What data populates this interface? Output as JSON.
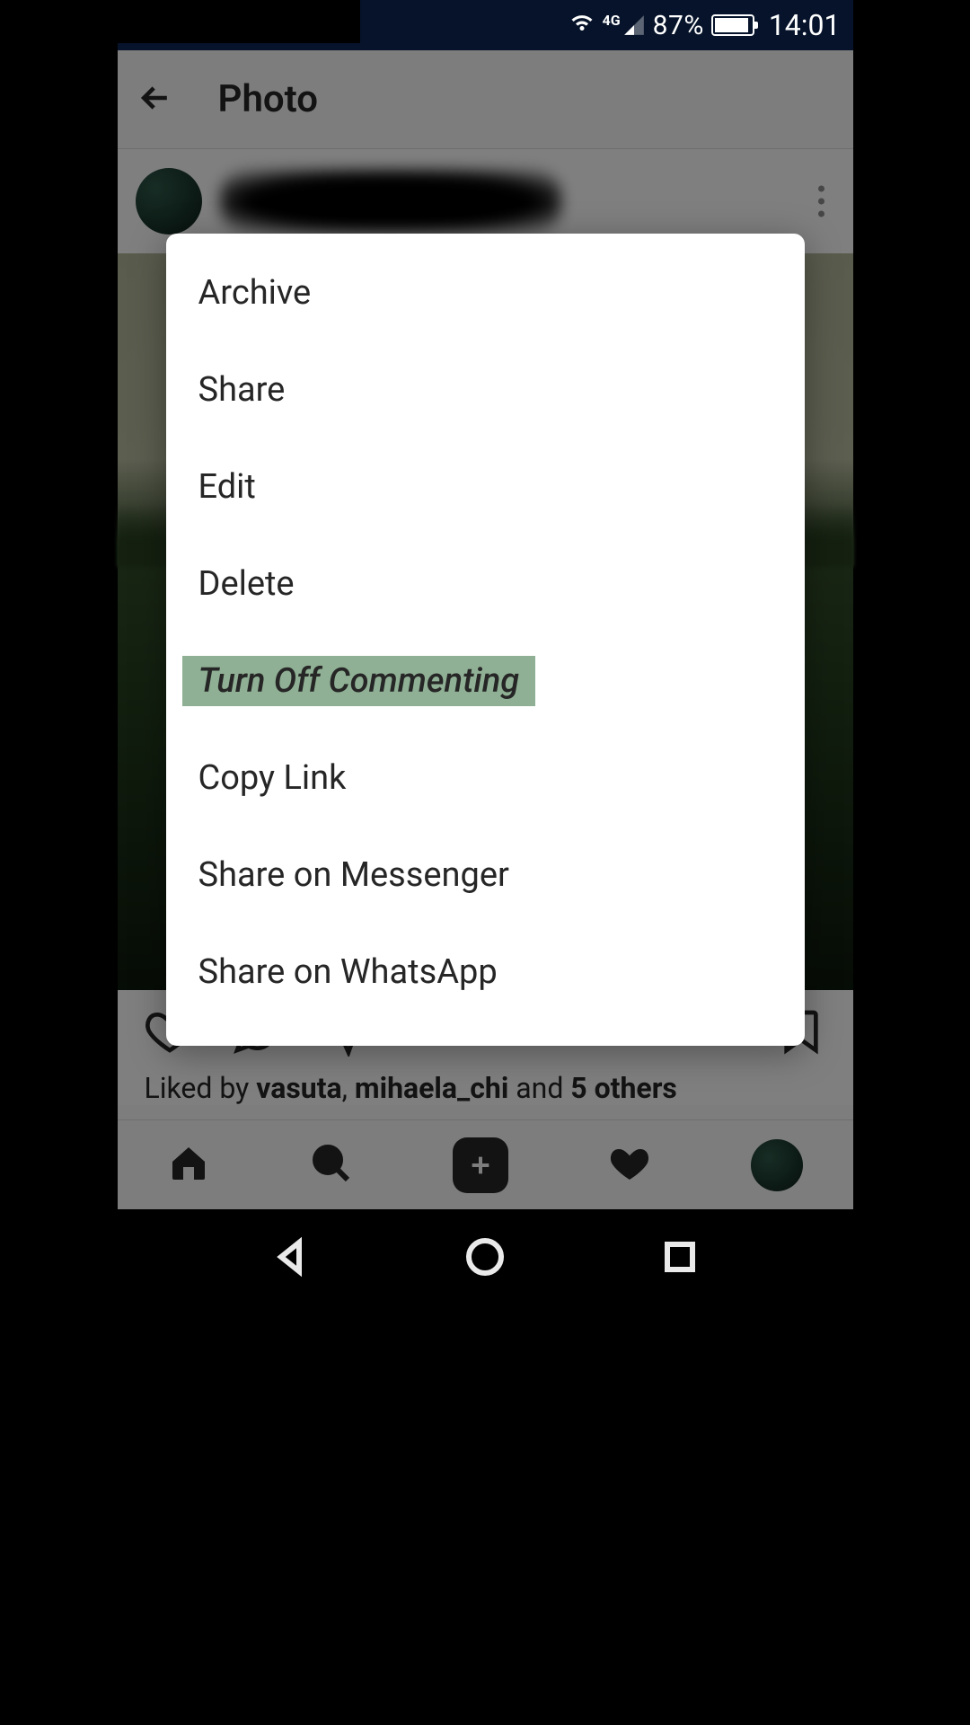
{
  "status_bar": {
    "network": "4G",
    "battery_percent": "87%",
    "time": "14:01"
  },
  "header": {
    "title": "Photo"
  },
  "post": {
    "likes_prefix": "Liked by ",
    "liker_1": "vasuta",
    "sep_1": ", ",
    "liker_2": "mihaela_chi",
    "mid": " and ",
    "others": "5 others"
  },
  "modal": {
    "items": [
      "Archive",
      "Share",
      "Edit",
      "Delete",
      "Turn Off Commenting",
      "Copy Link",
      "Share on Messenger",
      "Share on WhatsApp"
    ]
  }
}
